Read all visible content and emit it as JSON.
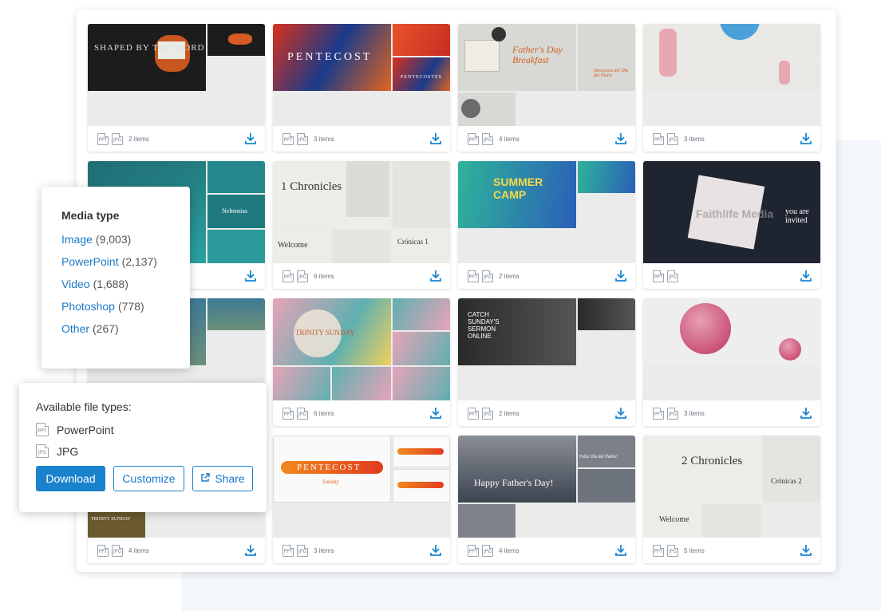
{
  "media_filter": {
    "title": "Media type",
    "options": [
      {
        "name": "Image",
        "count": "(9,003)"
      },
      {
        "name": "PowerPoint",
        "count": "(2,137)"
      },
      {
        "name": "Video",
        "count": "(1,688)"
      },
      {
        "name": "Photoshop",
        "count": "(778)"
      },
      {
        "name": "Other",
        "count": "(267)"
      }
    ]
  },
  "file_types_popup": {
    "title": "Available file types:",
    "types": [
      {
        "icon_text": "PPT",
        "label": "PowerPoint"
      },
      {
        "icon_text": "JPG",
        "label": "JPG"
      }
    ],
    "download_label": "Download",
    "customize_label": "Customize",
    "share_label": "Share"
  },
  "cards": [
    {
      "title": "SHAPED BY THE WORD",
      "side": "",
      "items": "2 items"
    },
    {
      "title": "PENTECOST",
      "side": "PENTECOSTÉS",
      "items": "3 items"
    },
    {
      "title": "Father's Day Breakfast",
      "side": "Desayuno del Día del Padre",
      "items": "4 items"
    },
    {
      "title": "",
      "side": "",
      "items": "3 items"
    },
    {
      "title": "",
      "side": "Nehemias",
      "items": ""
    },
    {
      "title": "1 Chronicles",
      "side": "Crónicas 1",
      "sub": "Welcome",
      "items": "6 items"
    },
    {
      "title": "SUMMER CAMP",
      "side": "",
      "items": "2 items"
    },
    {
      "title": "Faithlife Media",
      "side": "you are invited",
      "items": ""
    },
    {
      "title": "",
      "side": "",
      "items": ""
    },
    {
      "title": "TRINITY SUNDAY",
      "side": "",
      "items": "6 items"
    },
    {
      "title": "CATCH SUNDAY'S SERMON ONLINE",
      "side": "",
      "items": "2 items"
    },
    {
      "title": "",
      "side": "",
      "items": "3 items"
    },
    {
      "title": "TRINITY SUNDAY",
      "side": "",
      "items": "4 items"
    },
    {
      "title": "PENTECOST",
      "side": "Sunday",
      "items": "3 items"
    },
    {
      "title": "Happy Father's Day!",
      "side": "Feliz Día del Padre!",
      "items": "4 items"
    },
    {
      "title": "2 Chronicles",
      "side": "Crónicas 2",
      "sub": "Welcome",
      "items": "5 items"
    }
  ],
  "icons": {
    "ppt": "PPT",
    "jpg": "JPG"
  },
  "colors": {
    "accent": "#1a82cc",
    "link": "#1a79c8"
  }
}
